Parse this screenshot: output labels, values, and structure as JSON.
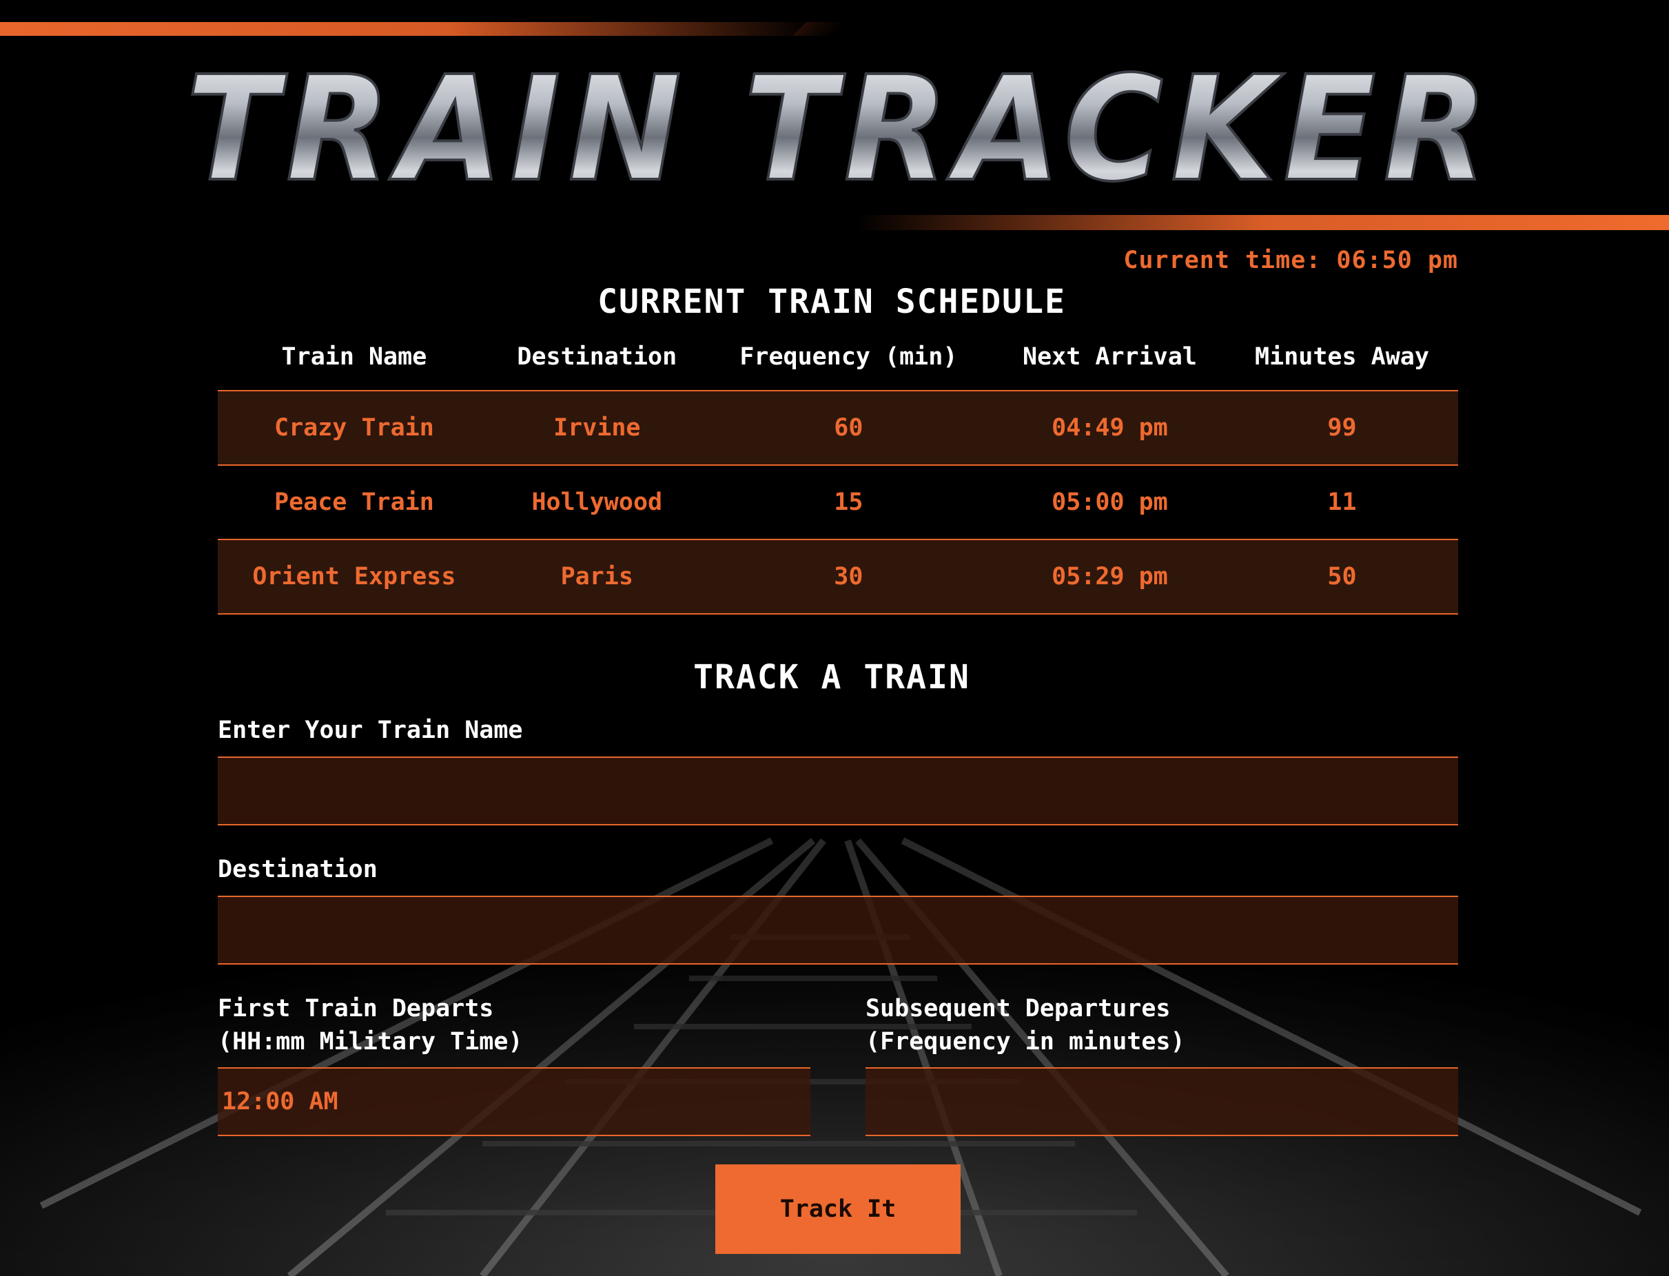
{
  "logo_text": "TRAIN TRACKER",
  "current_time": "Current time: 06:50 pm",
  "schedule": {
    "title": "CURRENT TRAIN SCHEDULE",
    "headers": [
      "Train Name",
      "Destination",
      "Frequency (min)",
      "Next Arrival",
      "Minutes Away"
    ],
    "rows": [
      [
        "Crazy Train",
        "Irvine",
        "60",
        "04:49 pm",
        "99"
      ],
      [
        "Peace Train",
        "Hollywood",
        "15",
        "05:00 pm",
        "11"
      ],
      [
        "Orient Express",
        "Paris",
        "30",
        "05:29 pm",
        "50"
      ]
    ]
  },
  "form": {
    "title": "TRACK A TRAIN",
    "train_name_label": "Enter Your Train Name",
    "train_name_value": "",
    "destination_label": "Destination",
    "destination_value": "",
    "first_train_label_1": "First Train Departs",
    "first_train_label_2": "(HH:mm Military Time)",
    "first_train_value": "12:00 AM",
    "frequency_label_1": "Subsequent Departures",
    "frequency_label_2": "(Frequency in minutes)",
    "frequency_value": "",
    "submit_label": "Track It"
  },
  "colors": {
    "accent": "#ee6a30",
    "row_bg": "#2f160b",
    "background": "#000000"
  }
}
